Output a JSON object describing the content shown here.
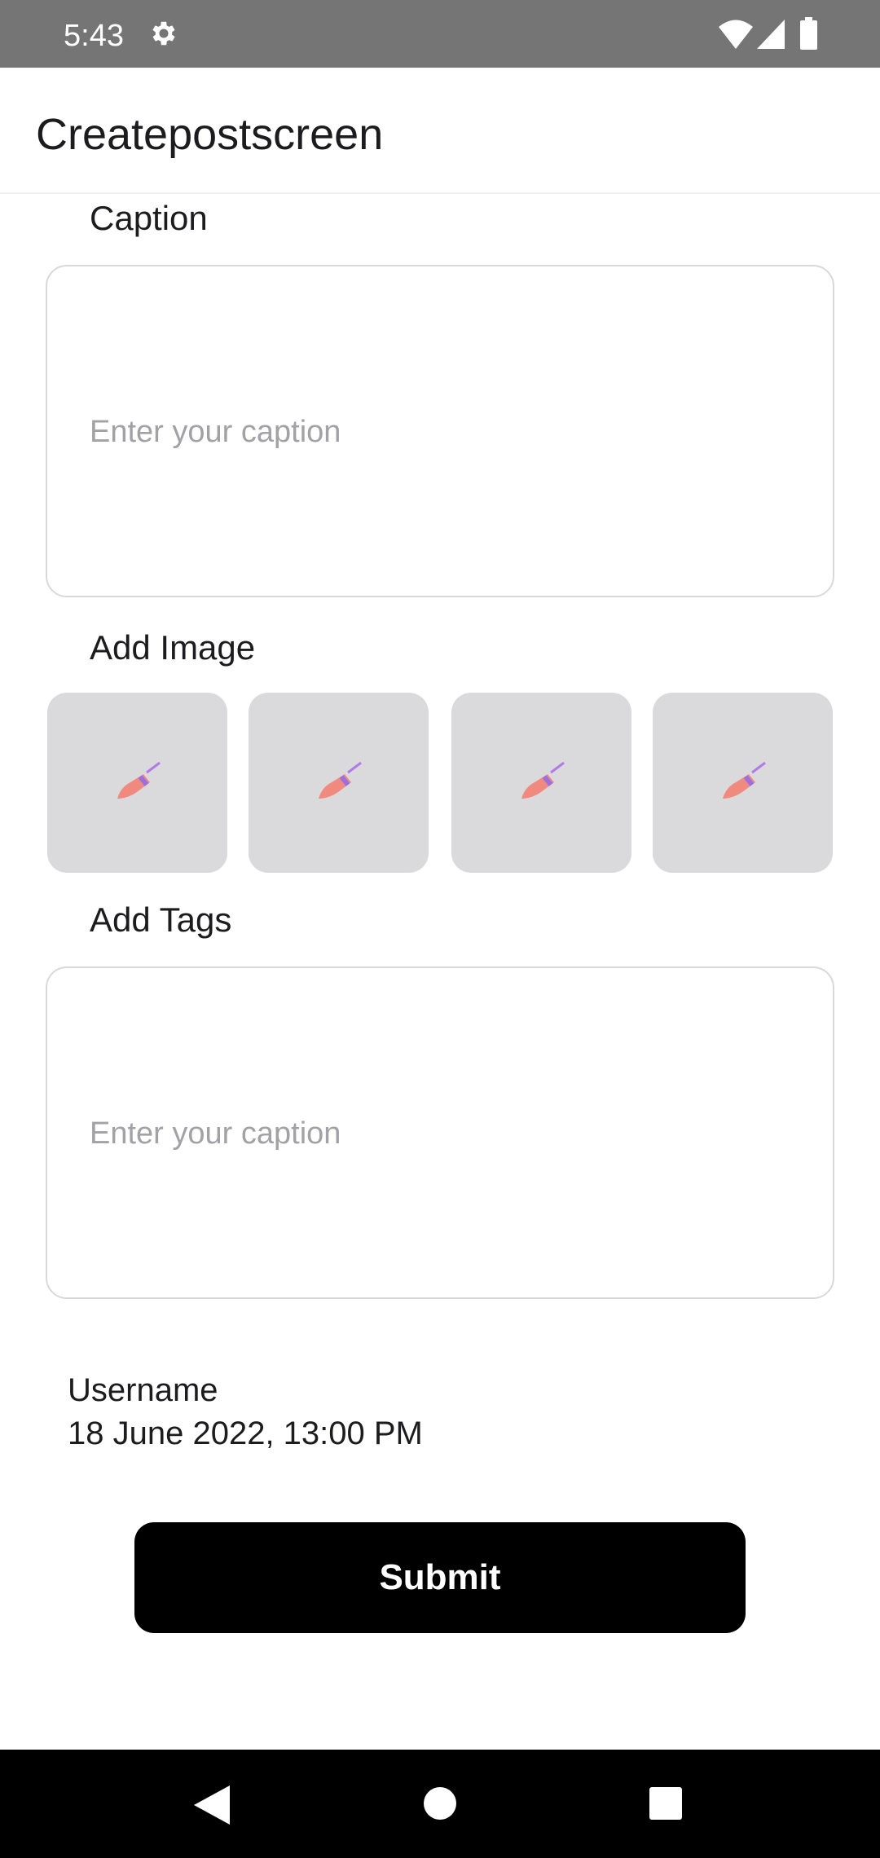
{
  "status_bar": {
    "time": "5:43",
    "icons": [
      "gear-icon",
      "wifi-icon",
      "cell-signal-icon",
      "battery-icon"
    ]
  },
  "app_bar": {
    "title": "Createpostscreen"
  },
  "caption_section": {
    "label": "Caption",
    "value": "",
    "placeholder": "Enter your caption"
  },
  "image_section": {
    "label": "Add Image",
    "slots": [
      {
        "icon": "pen-icon"
      },
      {
        "icon": "pen-icon"
      },
      {
        "icon": "pen-icon"
      },
      {
        "icon": "pen-icon"
      }
    ]
  },
  "tags_section": {
    "label": "Add Tags",
    "value": "",
    "placeholder": "Enter your caption"
  },
  "meta": {
    "username": "Username",
    "datetime": "18 June 2022, 13:00 PM"
  },
  "submit_label": "Submit",
  "nav_bar": {
    "icons": [
      "back-icon",
      "home-icon",
      "recents-icon"
    ]
  },
  "colors": {
    "status_bar": "#757575",
    "button": "#000000",
    "slot_bg": "#dadadd",
    "placeholder": "#a2a2a6",
    "pen_body": "#f08a7e",
    "pen_band": "#9b6fe0"
  }
}
